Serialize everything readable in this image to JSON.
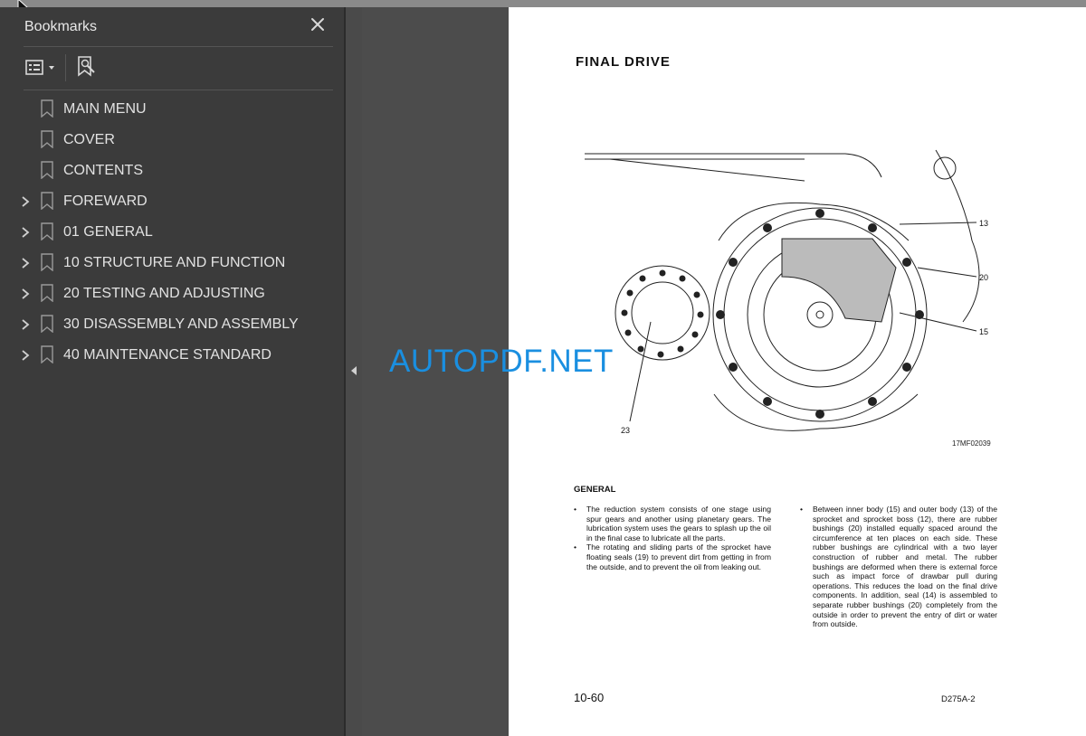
{
  "panel": {
    "title": "Bookmarks",
    "close_icon": "close-icon",
    "options_icon": "bookmark-options-icon",
    "find_icon": "find-current-bookmark-icon"
  },
  "bookmarks": [
    {
      "label": "MAIN MENU",
      "expandable": false
    },
    {
      "label": "COVER",
      "expandable": false
    },
    {
      "label": "CONTENTS",
      "expandable": false
    },
    {
      "label": "FOREWARD",
      "expandable": true
    },
    {
      "label": "01 GENERAL",
      "expandable": true
    },
    {
      "label": "10 STRUCTURE AND FUNCTION",
      "expandable": true
    },
    {
      "label": "20 TESTING AND ADJUSTING",
      "expandable": true
    },
    {
      "label": "30 DISASSEMBLY AND ASSEMBLY",
      "expandable": true
    },
    {
      "label": "40 MAINTENANCE STANDARD",
      "expandable": true
    }
  ],
  "document": {
    "title": "FINAL  DRIVE",
    "figure": {
      "callouts": [
        "13",
        "20",
        "15",
        "23"
      ],
      "id": "17MF02039"
    },
    "section_heading": "GENERAL",
    "col1": [
      "The reduction system consists of one stage using spur gears and another using planetary gears. The lubrication system uses the gears to splash up the oil in the final case to lubricate all the parts.",
      "The rotating and sliding parts of the sprocket have floating seals (19) to prevent dirt from getting in from the outside, and to prevent the oil from leaking out."
    ],
    "col2": [
      "Between inner body (15) and outer body (13) of the sprocket and sprocket boss (12), there are rubber bushings (20) installed equally spaced around the circumference at ten places on each side. These rubber bushings are cylindrical with a two layer construction of rubber and metal. The rubber bushings are deformed when there is external force such as impact force of drawbar pull during operations. This reduces the load on the final drive components. In addition, seal (14) is assembled to separate rubber bushings (20) completely from the outside in order to prevent the entry of dirt or water from outside."
    ],
    "page_number": "10-60",
    "model": "D275A-2"
  },
  "watermark": "AUTOPDF.NET",
  "colors": {
    "panel_bg": "#3b3b3b",
    "viewer_bg": "#4c4c4c",
    "watermark": "#1a8fe0"
  }
}
